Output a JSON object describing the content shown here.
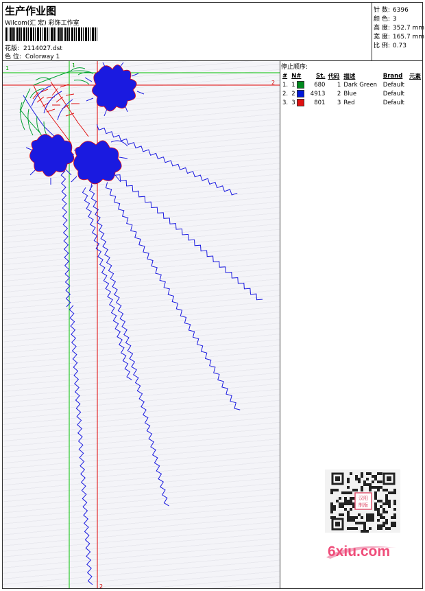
{
  "header": {
    "title": "生产作业图",
    "company": "Wilcom(汇 宏) 彩饰工作室",
    "design_label": "花版:",
    "design_value": "2114027.dst",
    "colorway_label": "色 位:",
    "colorway_value": "Colorway 1"
  },
  "stats": {
    "stitches_label": "针 数:",
    "stitches_value": "6396",
    "colors_label": "颜 色:",
    "colors_value": "3",
    "height_label": "高 度:",
    "height_value": "352.7 mm",
    "width_label": "宽 度:",
    "width_value": "165.7 mm",
    "scale_label": "比 例:",
    "scale_value": "0.73"
  },
  "guides": {
    "green_h": "1",
    "green_v": "1",
    "red_h": "2",
    "red_v": "2",
    "green_color": "#00c000",
    "red_color": "#e00000"
  },
  "stop_sequence": {
    "title": "停止顺序:",
    "headers": [
      "#",
      "N#",
      "St.",
      "代码",
      "描述",
      "Brand",
      "元素"
    ],
    "rows": [
      {
        "idx": "1.",
        "n": "1",
        "swatch": "#008a1e",
        "st": "680",
        "code": "1",
        "desc": "Dark Green",
        "brand": "Default"
      },
      {
        "idx": "2.",
        "n": "2",
        "swatch": "#0018d8",
        "st": "4913",
        "code": "2",
        "desc": "Blue",
        "brand": "Default"
      },
      {
        "idx": "3.",
        "n": "3",
        "swatch": "#e01010",
        "st": "801",
        "code": "3",
        "desc": "Red",
        "brand": "Default"
      }
    ]
  },
  "watermark": {
    "logo_text": "6xiu.com",
    "seal_text": "汉阳制版"
  },
  "colors": {
    "thread_blue": "#1a1ae0",
    "thread_red": "#e01010",
    "thread_green": "#00a030",
    "logo_pink": "#ef4d7a"
  }
}
